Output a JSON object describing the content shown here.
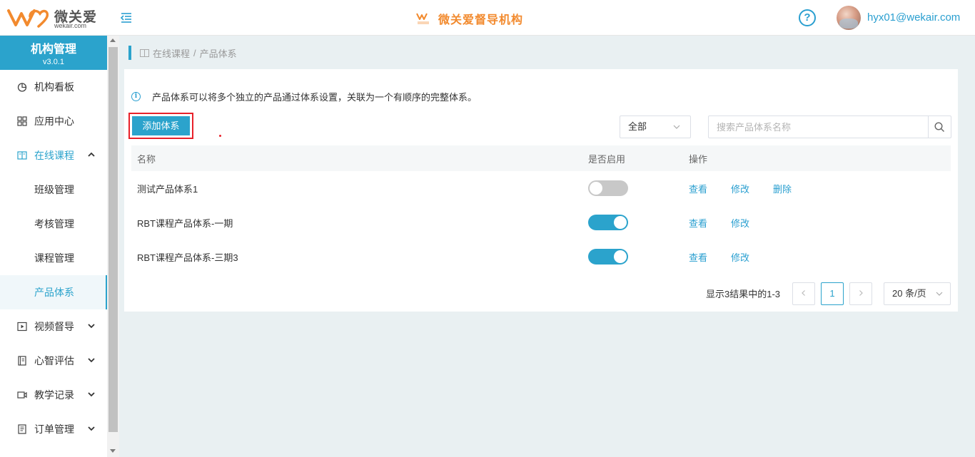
{
  "header": {
    "brand": "微关爱",
    "brand_domain": "wekair.com",
    "center_title": "微关爱督导机构",
    "help_symbol": "?",
    "user_email": "hyx01@wekair.com",
    "accent_color": "#2ba3cc",
    "brand_color": "#f28a2e"
  },
  "sidebar": {
    "title": "机构管理",
    "version": "v3.0.1",
    "items": [
      {
        "label": "机构看板",
        "icon": "chart-pie-icon"
      },
      {
        "label": "应用中心",
        "icon": "grid-icon"
      },
      {
        "label": "在线课程",
        "icon": "book-icon",
        "expanded": true,
        "children": [
          {
            "label": "班级管理"
          },
          {
            "label": "考核管理"
          },
          {
            "label": "课程管理"
          },
          {
            "label": "产品体系",
            "active": true
          }
        ]
      },
      {
        "label": "视频督导",
        "icon": "video-play-icon"
      },
      {
        "label": "心智评估",
        "icon": "notebook-icon"
      },
      {
        "label": "教学记录",
        "icon": "camera-icon"
      },
      {
        "label": "订单管理",
        "icon": "order-icon"
      }
    ]
  },
  "breadcrumb": {
    "parent": "在线课程",
    "separator": "/",
    "current": "产品体系"
  },
  "main": {
    "notice": "产品体系可以将多个独立的产品通过体系设置，关联为一个有顺序的完整体系。",
    "add_button": "添加体系",
    "filter_value": "全部",
    "search_placeholder": "搜索产品体系名称",
    "table": {
      "headers": [
        "名称",
        "是否启用",
        "操作"
      ],
      "rows": [
        {
          "name": "测试产品体系1",
          "enabled": false,
          "actions": [
            "查看",
            "修改",
            "删除"
          ]
        },
        {
          "name": "RBT课程产品体系-一期",
          "enabled": true,
          "actions": [
            "查看",
            "修改"
          ]
        },
        {
          "name": "RBT课程产品体系-三期3",
          "enabled": true,
          "actions": [
            "查看",
            "修改"
          ]
        }
      ]
    },
    "pagination": {
      "summary": "显示3结果中的1-3",
      "current_page": "1",
      "page_size": "20 条/页"
    }
  }
}
